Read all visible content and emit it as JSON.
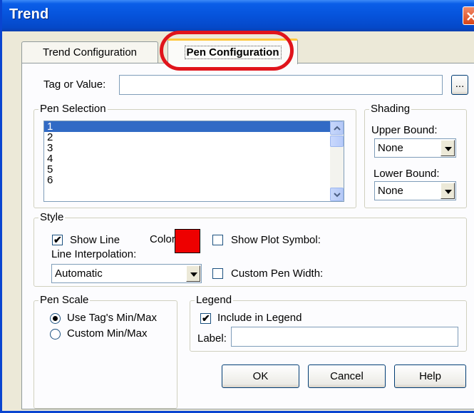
{
  "window": {
    "title": "Trend"
  },
  "tabs": [
    {
      "label": "Trend Configuration",
      "active": false
    },
    {
      "label": "Pen Configuration",
      "active": true
    }
  ],
  "tag": {
    "label": "Tag or Value:",
    "value": "",
    "browse_label": "..."
  },
  "pen_selection": {
    "title": "Pen Selection",
    "items": [
      "1",
      "2",
      "3",
      "4",
      "5",
      "6"
    ],
    "selected": "1"
  },
  "shading": {
    "title": "Shading",
    "upper_label": "Upper Bound:",
    "upper_value": "None",
    "lower_label": "Lower Bound:",
    "lower_value": "None"
  },
  "style": {
    "title": "Style",
    "show_line_label": "Show Line",
    "show_line_checked": true,
    "color_label": "Color:",
    "color_value": "#ee0000",
    "show_plot_symbol_label": "Show Plot Symbol:",
    "show_plot_symbol_checked": false,
    "interpolation_label": "Line Interpolation:",
    "interpolation_value": "Automatic",
    "custom_pen_width_label": "Custom Pen Width:",
    "custom_pen_width_checked": false
  },
  "pen_scale": {
    "title": "Pen Scale",
    "options": [
      "Use Tag's Min/Max",
      "Custom Min/Max"
    ],
    "selected": "Use Tag's Min/Max"
  },
  "legend": {
    "title": "Legend",
    "include_label": "Include in Legend",
    "include_checked": true,
    "label_label": "Label:",
    "label_value": ""
  },
  "buttons": {
    "ok": "OK",
    "cancel": "Cancel",
    "help": "Help"
  },
  "colors": {
    "titlebar": "#0653db",
    "selection": "#316ac5",
    "highlight_ring": "#e0141b",
    "tab_accent": "#ffc83c"
  }
}
